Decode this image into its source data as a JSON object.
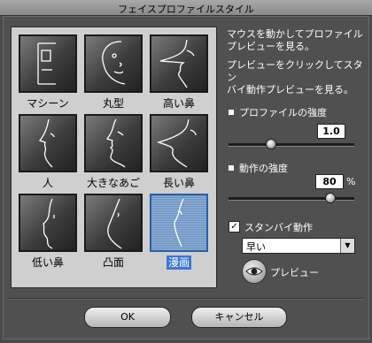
{
  "window": {
    "title": "フェイスプロファイルスタイル"
  },
  "profiles": [
    {
      "label": "マシーン"
    },
    {
      "label": "丸型"
    },
    {
      "label": "高い鼻"
    },
    {
      "label": "人"
    },
    {
      "label": "大きなあご"
    },
    {
      "label": "長い鼻"
    },
    {
      "label": "低い鼻"
    },
    {
      "label": "凸面"
    },
    {
      "label": "漫画",
      "selected": true
    }
  ],
  "help": {
    "hover": "マウスを動かしてプロファイル\nプレビューを見る。",
    "click": "プレビューをクリックしてスタン\nバイ動作プレビューを見る。"
  },
  "profile_strength": {
    "label": "プロファイルの強度",
    "value": "1.0",
    "level": 0.33
  },
  "motion_strength": {
    "label": "動作の強度",
    "value": "80",
    "unit": "%",
    "level": 0.8
  },
  "standby": {
    "label": "スタンバイ動作",
    "checked": true,
    "check_glyph": "✓",
    "speed": "早い",
    "arrow": "▼"
  },
  "preview_label": "プレビュー",
  "buttons": {
    "ok": "OK",
    "cancel": "キャンセル"
  },
  "colors": {
    "selection": "#3b76d8"
  }
}
